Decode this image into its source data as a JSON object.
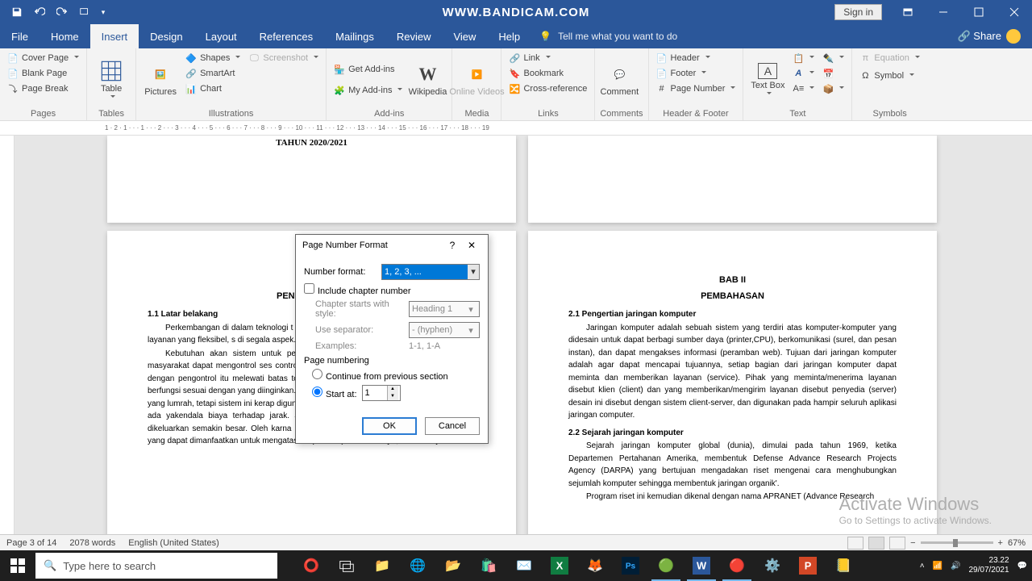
{
  "titlebar": {
    "brand": "WWW.BANDICAM.COM",
    "signin": "Sign in"
  },
  "tabs": {
    "file": "File",
    "home": "Home",
    "insert": "Insert",
    "design": "Design",
    "layout": "Layout",
    "references": "References",
    "mailings": "Mailings",
    "review": "Review",
    "view": "View",
    "help": "Help",
    "tellme": "Tell me what you want to do",
    "share": "Share"
  },
  "ribbon": {
    "pages": {
      "cover": "Cover Page",
      "blank": "Blank Page",
      "break": "Page Break",
      "group": "Pages"
    },
    "tables": {
      "table": "Table",
      "group": "Tables"
    },
    "illus": {
      "pictures": "Pictures",
      "shapes": "Shapes",
      "smartart": "SmartArt",
      "chart": "Chart",
      "screenshot": "Screenshot",
      "group": "Illustrations"
    },
    "addins": {
      "get": "Get Add-ins",
      "my": "My Add-ins",
      "wiki": "Wikipedia",
      "group": "Add-ins"
    },
    "media": {
      "online": "Online Videos",
      "group": "Media"
    },
    "links": {
      "link": "Link",
      "bookmark": "Bookmark",
      "xref": "Cross-reference",
      "group": "Links"
    },
    "comments": {
      "comment": "Comment",
      "group": "Comments"
    },
    "hf": {
      "header": "Header",
      "footer": "Footer",
      "pagenum": "Page Number",
      "group": "Header & Footer"
    },
    "text": {
      "textbox": "Text Box",
      "group": "Text"
    },
    "symbols": {
      "equation": "Equation",
      "symbol": "Symbol",
      "group": "Symbols"
    }
  },
  "ruler": "1 · 2 · 1 · · · 1 · · · 2 · · · 3 · · · 4 · · · 5 · · · 6 · · · 7 · · · 8 · · · 9 · · · 10 · · · 11 · · · 12 · · · 13 · · · 14 · · · 15 · · · 16 · · · 17 · · · 18 · · · 19",
  "doc": {
    "p1_title": "TAHUN 2020/2021",
    "p3": {
      "pen": "PEN",
      "s11": "1.1 Latar belakang",
      "para1": "Perkembangan di dalam teknologi t dengan perkembangan karakteristi tinggi, mencari layanan yang fleksibel, s di segala aspek.",
      "para2": "Kebutuhan akan sistem untuk peng era globalisasi dimana perpindahan da ini masyarakat dapat mengontrol ses control, akan tetapi pengontrolan terseb yang dikontrol dengan pengontrol itu melewati batas toleransinya, maka peralatan tersebut tidak dapat berfungsi sesuai dengan yang diinginkan. Pengontrolan melalui jalur telepon merupakan hal yang lumrah, tetapi sistem ini kerap digunakan untuk sistem fix-point to point. Selain itu juga ada yakendala biaya terhadap jarak. Jarak semangkin jauh maka biaya pulsa yang dikeluarkan semakin besar. Oleh karna itu teknologi jaringan komputer merupakan solusi yang dapat dimanfaatkan untuk mengatasi fix-point to point dan biaya, serta menjadi"
    },
    "p4": {
      "bab": "BAB II",
      "pemb": "PEMBAHASAN",
      "s21": "2.1 Pengertian jaringan komputer",
      "para21": "Jaringan komputer adalah sebuah sistem yang terdiri atas  komputer-komputer yang didesain untuk dapat berbagi sumber daya (printer,CPU), berkomunikasi (surel, dan pesan instan), dan dapat mengakses informasi (peramban web). Tujuan dari jaringan komputer adalah agar dapat mencapai tujuannya, setiap bagian dari jaringan komputer dapat meminta dan memberikan layanan (service). Pihak yang meminta/menerima layanan disebut klien (client) dan yang memberikan/mengirim layanan disebut penyedia (server) desain ini disebut dengan sistem client-server, dan digunakan pada hampir seluruh aplikasi jaringan computer.",
      "s22": "2.2 Sejarah jaringan komputer",
      "para22": "Sejarah jaringan komputer global (dunia), dimulai pada tahun 1969, ketika Departemen Pertahanan Amerika, membentuk Defense Advance Research Projects Agency (DARPA) yang bertujuan mengadakan riset mengenai cara menghubungkan sejumlah komputer sehingga membentuk jaringan organik'.",
      "para23": "Program riset ini kemudian dikenal dengan nama APRANET (Advance Research"
    }
  },
  "dialog": {
    "title": "Page Number Format",
    "numfmt_lbl": "Number format:",
    "numfmt_val": "1, 2, 3, ...",
    "include_chapter": "Include chapter number",
    "chap_style_lbl": "Chapter starts with style:",
    "chap_style_val": "Heading 1",
    "sep_lbl": "Use separator:",
    "sep_val": "-   (hyphen)",
    "examples_lbl": "Examples:",
    "examples_val": "1-1, 1-A",
    "pagenum_section": "Page numbering",
    "continue": "Continue from previous section",
    "startat": "Start at:",
    "startat_val": "1",
    "ok": "OK",
    "cancel": "Cancel"
  },
  "status": {
    "page": "Page 3 of 14",
    "words": "2078 words",
    "lang": "English (United States)",
    "zoom": "67%"
  },
  "watermark": {
    "l1": "Activate Windows",
    "l2": "Go to Settings to activate Windows."
  },
  "taskbar": {
    "search_ph": "Type here to search",
    "time": "23.22",
    "date": "29/07/2021"
  }
}
